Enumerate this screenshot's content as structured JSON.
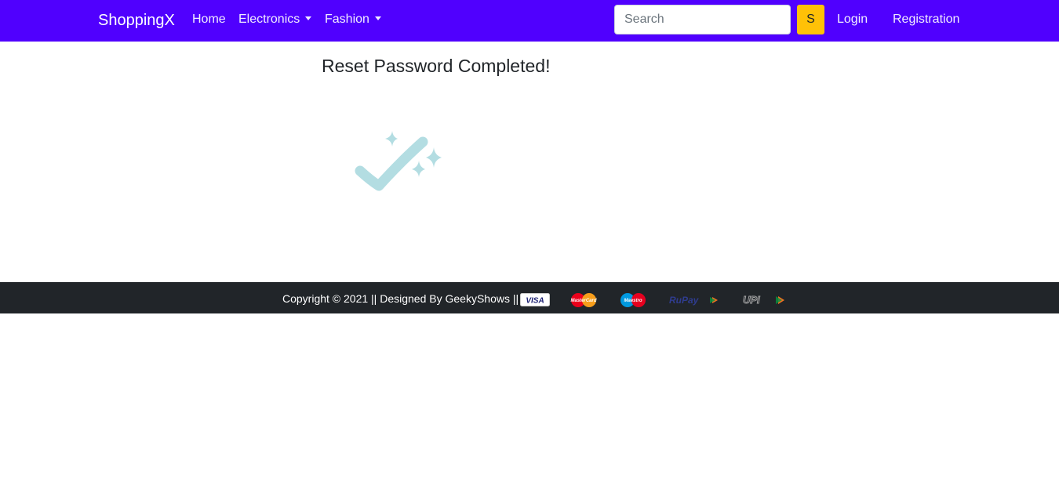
{
  "navbar": {
    "brand": "ShoppingX",
    "links": {
      "home": "Home",
      "electronics": "Electronics",
      "fashion": "Fashion",
      "login": "Login",
      "registration": "Registration"
    },
    "search": {
      "placeholder": "Search",
      "value": "",
      "button_label": "S"
    },
    "colors": {
      "background": "#5000fe",
      "search_button": "#ffc107"
    }
  },
  "main": {
    "title": "Reset Password Completed!",
    "illustration_icon": "checkmark-sparkles-icon"
  },
  "footer": {
    "copyright": "Copyright © 2021 || Designed By GeekyShows ||",
    "payment_logos": {
      "visa": "VISA",
      "mastercard": "MasterCard",
      "maestro": "Maestro",
      "rupay": "RuPay",
      "upi": "UPI"
    },
    "background": "#212529"
  }
}
